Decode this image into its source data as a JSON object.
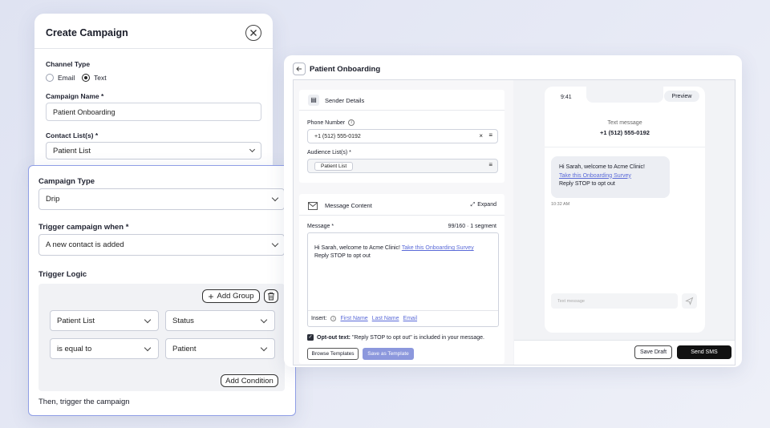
{
  "campaign": {
    "title": "Create Campaign",
    "channel_label": "Channel Type",
    "channel_email": "Email",
    "channel_text": "Text",
    "name_label": "Campaign Name *",
    "name_value": "Patient Onboarding",
    "contacts_label": "Contact List(s) *",
    "contacts_value": "Patient List"
  },
  "trigger": {
    "type_label": "Campaign Type",
    "type_value": "Drip",
    "when_label": "Trigger campaign when *",
    "when_value": "A new contact is added",
    "logic_label": "Trigger Logic",
    "add_group": "Add Group",
    "cond1_left": "Patient List",
    "cond1_right": "Status",
    "cond2_left": "is equal to",
    "cond2_right": "Patient",
    "add_condition": "Add Condition",
    "then_text": "Then, trigger the campaign"
  },
  "onboarding": {
    "title": "Patient Onboarding",
    "sender_title": "Sender Details",
    "phone_label": "Phone Number",
    "phone_value": "+1 (512) 555-0192",
    "audience_label": "Audience List(s) *",
    "audience_chip": "Patient List",
    "message_title": "Message Content",
    "expand": "Expand",
    "message_label": "Message *",
    "segment": "99/160 · 1 segment",
    "msg_line1": "Hi Sarah, welcome to Acme Clinic!",
    "msg_link": "Take this Onboarding Survey",
    "msg_line2": "Reply STOP to opt out",
    "insert_label": "Insert:",
    "insert_first": "First Name",
    "insert_last": "Last Name",
    "insert_email": "Email",
    "optout_bold": "Opt-out text:",
    "optout_rest": "\"Reply STOP to opt out\" is included in your message.",
    "browse": "Browse Templates",
    "save_template": "Save as Template",
    "save_draft": "Save Draft",
    "send_sms": "Send SMS"
  },
  "phone": {
    "time": "9:41",
    "preview": "Preview",
    "header_sub": "Text message",
    "header_num": "+1 (512) 555-0192",
    "bubble_line1": "Hi Sarah,  welcome to Acme Clinic!",
    "bubble_link": "Take this Onboarding Survey",
    "bubble_line3": "Reply STOP to opt out",
    "bubble_time": "10:32 AM",
    "input_placeholder": "Text message"
  }
}
